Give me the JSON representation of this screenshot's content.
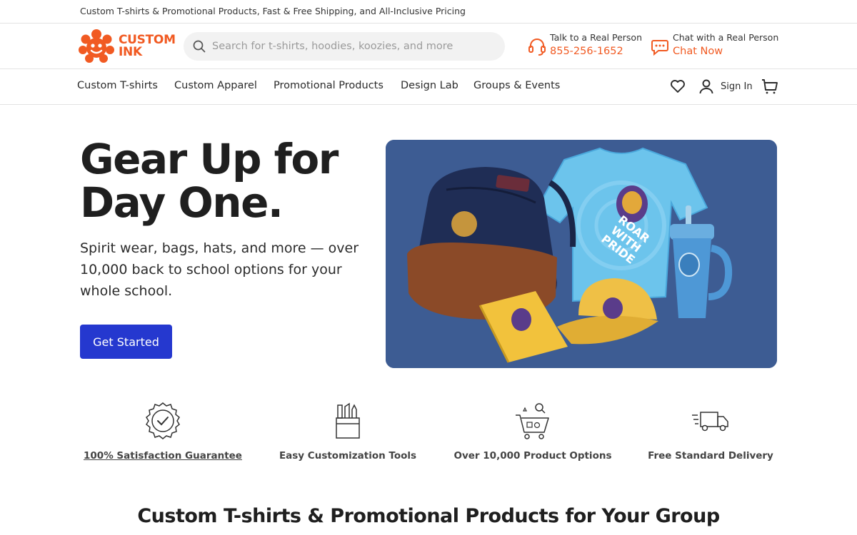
{
  "announcement": "Custom T-shirts & Promotional Products, Fast & Free Shipping, and All-Inclusive Pricing",
  "brand": {
    "line1": "CUSTOM",
    "line2": "INK",
    "color": "#f15a22"
  },
  "search": {
    "placeholder": "Search for t-shirts, hoodies, koozies, and more"
  },
  "contact": {
    "phone": {
      "label": "Talk to a Real Person",
      "value": "855-256-1652",
      "icon": "headset-icon"
    },
    "chat": {
      "label": "Chat with a Real Person",
      "value": "Chat Now",
      "icon": "chat-bubble-icon"
    }
  },
  "nav": {
    "items": [
      "Custom T-shirts",
      "Custom Apparel",
      "Promotional Products",
      "Design Lab",
      "Groups & Events"
    ],
    "sign_in": "Sign In"
  },
  "hero": {
    "title_line1": "Gear Up for",
    "title_line2": "Day One.",
    "subtitle": "Spirit wear, bags, hats, and more — over 10,000 back to school options for your whole school.",
    "cta": "Get Started",
    "cta_color": "#2538cf",
    "image_bg": "#3d5c93",
    "shirt_text": "ROAR WITH PRIDE"
  },
  "features": [
    {
      "label": "100% Satisfaction Guarantee",
      "icon": "badge-check-icon"
    },
    {
      "label": "Easy Customization Tools",
      "icon": "design-tools-icon"
    },
    {
      "label": "Over 10,000 Product Options",
      "icon": "shopping-cart-icon"
    },
    {
      "label": "Free Standard Delivery",
      "icon": "delivery-truck-icon"
    }
  ],
  "section": {
    "title": "Custom T-shirts & Promotional Products for Your Group"
  }
}
